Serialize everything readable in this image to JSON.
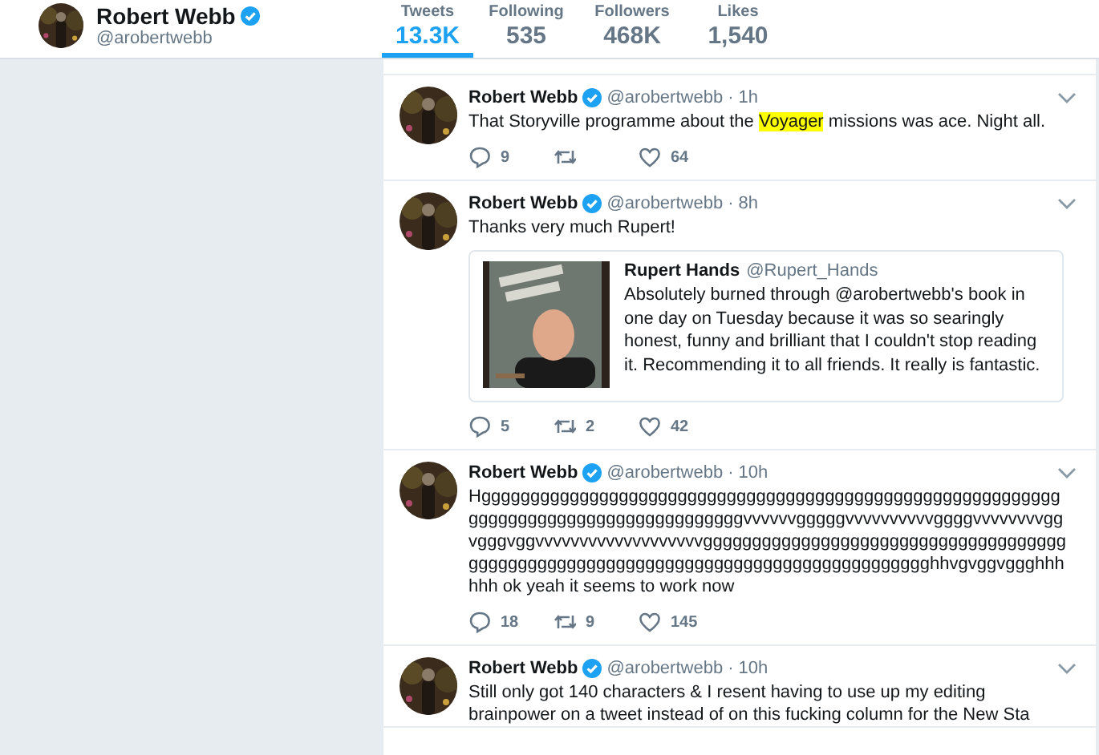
{
  "profile": {
    "name": "Robert Webb",
    "handle": "@arobertwebb",
    "verified": true
  },
  "stats": [
    {
      "label": "Tweets",
      "value": "13.3K",
      "selected": true
    },
    {
      "label": "Following",
      "value": "535",
      "selected": false
    },
    {
      "label": "Followers",
      "value": "468K",
      "selected": false
    },
    {
      "label": "Likes",
      "value": "1,540",
      "selected": false
    }
  ],
  "tweets": [
    {
      "name": "Robert Webb",
      "verified": true,
      "handle": "@arobertwebb",
      "time": "· 1h",
      "parts": [
        {
          "text": "That Storyville programme about the ",
          "highlighted": false
        },
        {
          "text": "Voyager",
          "highlighted": true
        },
        {
          "text": " missions was ace. Night all.",
          "highlighted": false
        }
      ],
      "actions": [
        {
          "kind": "reply",
          "count": "9"
        },
        {
          "kind": "retweet"
        },
        {
          "kind": "like",
          "count": "64"
        }
      ]
    },
    {
      "name": "Robert Webb",
      "verified": true,
      "handle": "@arobertwebb",
      "time": "· 8h",
      "parts": [
        {
          "text": "Thanks very much Rupert!",
          "highlighted": false
        }
      ],
      "quote": {
        "name": "Rupert Hands",
        "handle": "@Rupert_Hands",
        "text": "Absolutely burned through @arobertwebb's book in one day on Tuesday because it was so searingly honest, funny and brilliant that I couldn't stop reading it. Recommending it to all friends. It really is fantastic."
      },
      "actions": [
        {
          "kind": "reply",
          "count": "5"
        },
        {
          "kind": "retweet",
          "count": "2"
        },
        {
          "kind": "like",
          "count": "42"
        }
      ]
    },
    {
      "name": "Robert Webb",
      "verified": true,
      "handle": "@arobertwebb",
      "time": "· 10h",
      "parts": [
        {
          "text": "Hgggggggggggggggggggggggggggggggggggggggggggggggggggggggggggggggggggggggggggggggggggggggvvvvvvgggggvvvvvvvvvvggggvvvvvvvvggvgggvggvvvvvvvvvvvvvvvvvvvgggggggggggggggggggggggggggggggggggggggggggggggggggggggggggggggggggggggggggggggggggghhvgvggvggghhhhhh ok yeah it seems to work now",
          "highlighted": false
        }
      ],
      "actions": [
        {
          "kind": "reply",
          "count": "18"
        },
        {
          "kind": "retweet",
          "count": "9"
        },
        {
          "kind": "like",
          "count": "145"
        }
      ]
    },
    {
      "name": "Robert Webb",
      "verified": true,
      "handle": "@arobertwebb",
      "time": "· 10h",
      "parts": [
        {
          "text": "Still only got 140 characters & I resent having to use up my editing brainpower on a tweet instead of on this fucking column for the New Sta",
          "highlighted": false
        }
      ]
    }
  ]
}
